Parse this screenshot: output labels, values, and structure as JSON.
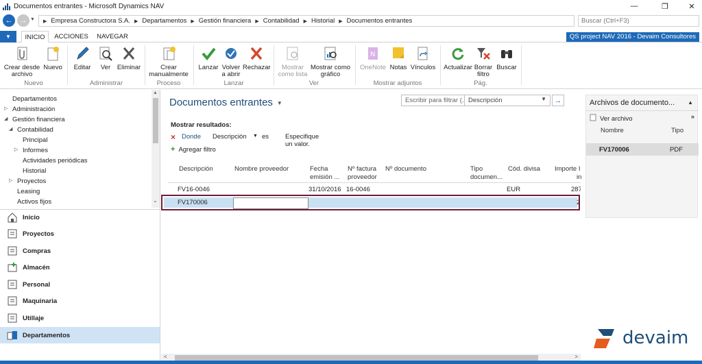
{
  "window": {
    "title": "Documentos entrantes - Microsoft Dynamics NAV",
    "controls": [
      "—",
      "❐",
      "✕"
    ]
  },
  "address": {
    "crumbs": [
      "Empresa Constructora S.A.",
      "Departamentos",
      "Gestión financiera",
      "Contabilidad",
      "Historial",
      "Documentos entrantes"
    ],
    "search_placeholder": "Buscar (Ctrl+F3)"
  },
  "ribbon": {
    "tabs": [
      "INICIO",
      "ACCIONES",
      "NAVEGAR"
    ],
    "active_tab": "INICIO",
    "company": "QS project NAV 2016 - Devaim Consultores",
    "groups": {
      "nuevo": "Nuevo",
      "administrar": "Administrar",
      "proceso": "Proceso",
      "lanzar": "Lanzar",
      "ver": "Ver",
      "mostrar_adjuntos": "Mostrar adjuntos",
      "pag": "Pág."
    },
    "buttons": {
      "crear_desde_archivo": [
        "Crear desde",
        "archivo"
      ],
      "nuevo": [
        "Nuevo"
      ],
      "editar": [
        "Editar"
      ],
      "ver": [
        "Ver"
      ],
      "eliminar": [
        "Eliminar"
      ],
      "crear_manualmente": [
        "Crear",
        "manualmente"
      ],
      "lanzar": [
        "Lanzar"
      ],
      "volver_a_abrir": [
        "Volver",
        "a abrir"
      ],
      "rechazar": [
        "Rechazar"
      ],
      "mostrar_como_lista": [
        "Mostrar",
        "como lista"
      ],
      "mostrar_como_grafico": [
        "Mostrar como",
        "gráfico"
      ],
      "onenote": [
        "OneNote"
      ],
      "notas": [
        "Notas"
      ],
      "vinculos": [
        "Vínculos"
      ],
      "actualizar": [
        "Actualizar"
      ],
      "borrar_filtro": [
        "Borrar",
        "filtro"
      ],
      "buscar": [
        "Buscar"
      ]
    }
  },
  "nav": {
    "tree": [
      "Departamentos",
      "Administración",
      "Gestión financiera",
      "Contabilidad",
      "Principal",
      "Informes",
      "Actividades periódicas",
      "Historial",
      "Proyectos",
      "Leasing",
      "Activos fijos"
    ],
    "buttons": [
      "Inicio",
      "Proyectos",
      "Compras",
      "Almacén",
      "Personal",
      "Maquinaria",
      "Utillaje",
      "Departamentos"
    ],
    "active": "Departamentos"
  },
  "main": {
    "title": "Documentos entrantes",
    "filter_label": "Escribir para filtrar (...",
    "filter_field": "Descripción",
    "show_results": "Mostrar resultados:",
    "filter": {
      "where": "Donde",
      "field": "Descripción",
      "op": "es",
      "value": "Especifique un valor."
    },
    "add_filter": "Agregar filtro",
    "columns": [
      [
        "Descripción"
      ],
      [
        "Nombre proveedor"
      ],
      [
        "Fecha",
        "emisión ..."
      ],
      [
        "Nº factura",
        "proveedor"
      ],
      [
        "Nº documento"
      ],
      [
        "Tipo",
        "documen..."
      ],
      [
        "Cód. divisa"
      ],
      [
        "Importe I",
        "in"
      ]
    ],
    "rows": [
      [
        "FV16-0046",
        "",
        "31/10/2016",
        "16-0046",
        "",
        "",
        "EUR",
        "287"
      ],
      [
        "FV170006",
        "",
        "",
        "",
        "",
        "",
        "",
        "2"
      ]
    ]
  },
  "factbox": {
    "title": "Archivos de documento...",
    "view_file": "Ver archivo",
    "columns": [
      "Nombre",
      "Tipo"
    ],
    "rows": [
      [
        "FV170006",
        "PDF"
      ]
    ]
  },
  "logo": "devaim",
  "colors": {
    "accent": "#1e6ab8",
    "title_blue": "#1e4e79",
    "selection": "#c9e0f3",
    "highlight_border": "#6e1d3a"
  }
}
